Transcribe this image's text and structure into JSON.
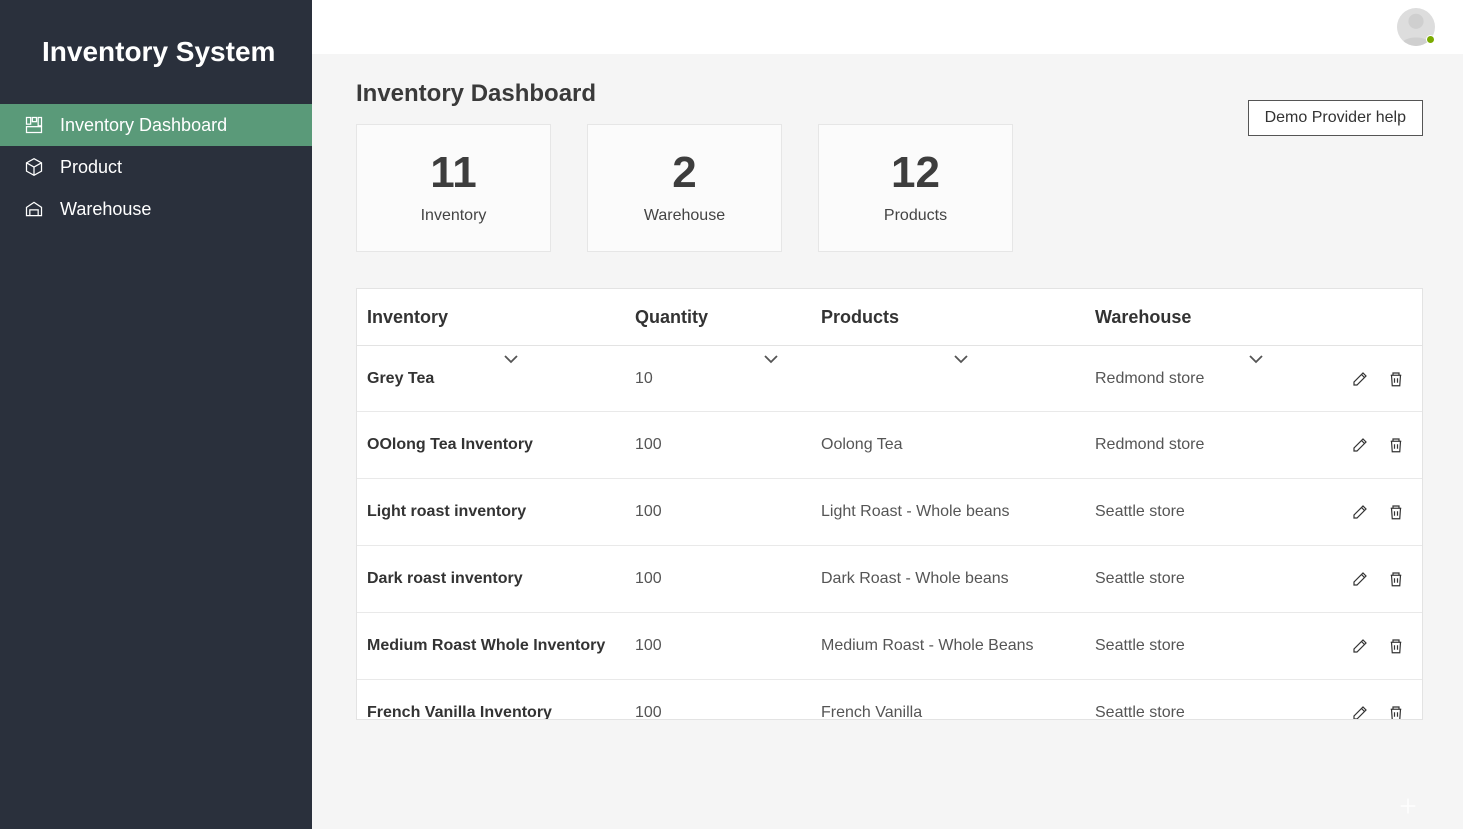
{
  "app_title": "Inventory System",
  "sidebar": {
    "items": [
      {
        "label": "Inventory Dashboard",
        "active": true
      },
      {
        "label": "Product",
        "active": false
      },
      {
        "label": "Warehouse",
        "active": false
      }
    ]
  },
  "page_title": "Inventory Dashboard",
  "help_button_label": "Demo Provider help",
  "cards": [
    {
      "value": "11",
      "label": "Inventory"
    },
    {
      "value": "2",
      "label": "Warehouse"
    },
    {
      "value": "12",
      "label": "Products"
    }
  ],
  "table": {
    "headers": {
      "inventory": "Inventory",
      "quantity": "Quantity",
      "products": "Products",
      "warehouse": "Warehouse"
    },
    "rows": [
      {
        "inventory": "Grey Tea",
        "quantity": "10",
        "products": "",
        "warehouse": "Redmond store"
      },
      {
        "inventory": "OOlong Tea Inventory",
        "quantity": "100",
        "products": "Oolong Tea",
        "warehouse": "Redmond store"
      },
      {
        "inventory": "Light roast inventory",
        "quantity": "100",
        "products": "Light Roast - Whole beans",
        "warehouse": "Seattle store"
      },
      {
        "inventory": "Dark roast inventory",
        "quantity": "100",
        "products": "Dark Roast - Whole beans",
        "warehouse": "Seattle store"
      },
      {
        "inventory": "Medium Roast Whole Inventory",
        "quantity": "100",
        "products": "Medium Roast - Whole Beans",
        "warehouse": "Seattle store"
      },
      {
        "inventory": "French Vanilla Inventory",
        "quantity": "100",
        "products": "French Vanilla",
        "warehouse": "Seattle store"
      }
    ]
  }
}
